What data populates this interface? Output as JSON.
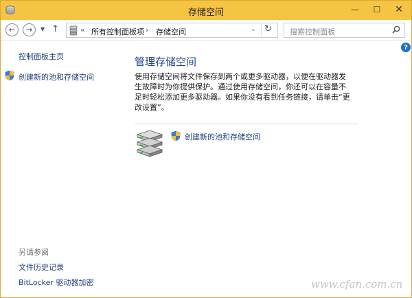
{
  "window": {
    "title": "存储空间",
    "minimize_glyph": "—",
    "maximize_glyph": "☐",
    "close_glyph": "✕",
    "accent_color": "#f6c443"
  },
  "navbar": {
    "back_glyph": "←",
    "forward_glyph": "→",
    "recent_glyph": "▼",
    "up_glyph": "↑",
    "address": {
      "root_separator": "«",
      "crumbs": [
        "所有控制面板项",
        "存储空间"
      ],
      "separator": "›",
      "dropdown_glyph": "⌄",
      "refresh_glyph": "↻"
    },
    "search": {
      "placeholder": "搜索控制面板"
    }
  },
  "help_glyph": "?",
  "sidebar": {
    "home_link": "控制面板主页",
    "create_link": "创建新的池和存储空间",
    "see_also_label": "另请参阅",
    "see_also_links": [
      "文件历史记录",
      "BitLocker 驱动器加密"
    ]
  },
  "main": {
    "title": "管理存储空间",
    "description": "使用存储空间将文件保存到两个或更多驱动器，以便在驱动器发生故障时为你提供保护。通过使用存储空间，你还可以在容量不足时轻松添加更多驱动器。如果你没有看到任务链接，请单击“更改设置”。",
    "create_link": "创建新的池和存储空间"
  },
  "watermark": {
    "text": "www.cfan.com.cn"
  },
  "icons": {
    "app": "storage-spaces-icon",
    "shield": "uac-shield-icon",
    "drives": "drive-stack-icon",
    "search": "search-icon"
  }
}
